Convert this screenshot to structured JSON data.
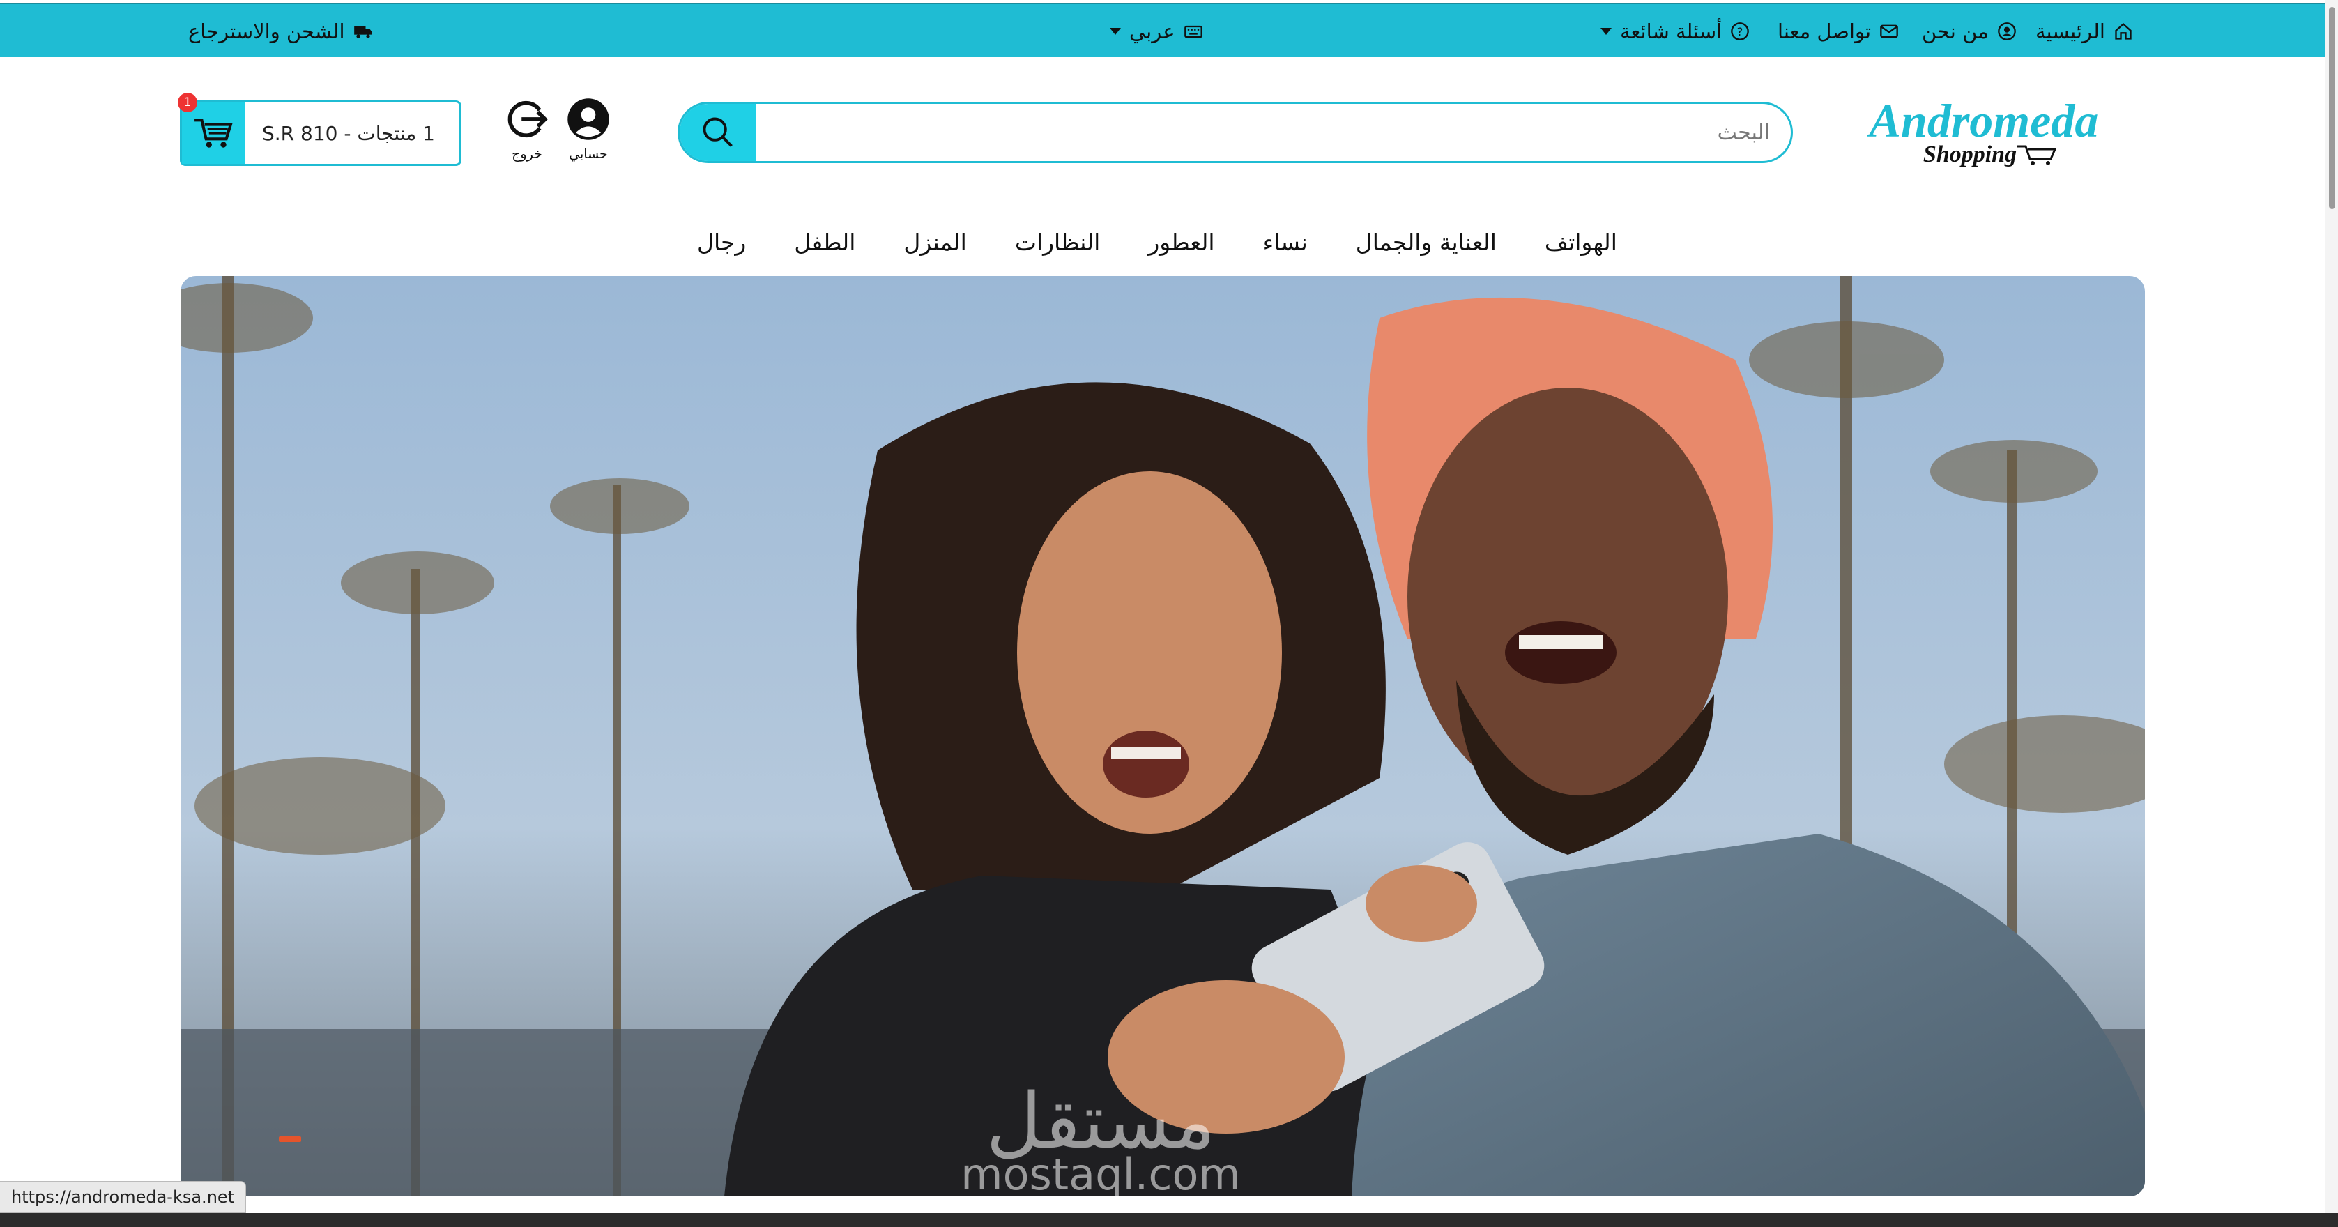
{
  "topbar": {
    "home": "الرئيسية",
    "about": "من نحن",
    "contact": "تواصل معنا",
    "faq": "أسئلة شائعة",
    "language": "عربي",
    "shipping": "الشحن والاسترجاع"
  },
  "header": {
    "logo_main": "Andromeda",
    "logo_sub": "Shopping",
    "search_placeholder": "البحث",
    "account_label": "حسابي",
    "logout_label": "خروج",
    "cart_summary": "1 منتجات - 810 S.R",
    "cart_count": "1"
  },
  "nav": {
    "items": [
      "الهواتف",
      "العناية والجمال",
      "نساء",
      "العطور",
      "النظارات",
      "المنزل",
      "الطفل",
      "رجال"
    ]
  },
  "hero": {
    "watermark_ar": "مستقل",
    "watermark_en": "mostaql.com"
  },
  "status_bar": {
    "url": "https://andromeda-ksa.net"
  },
  "colors": {
    "accent": "#1fbcd3",
    "button": "#1fd0e6",
    "badge": "#e33333",
    "slider_dot": "#e5542b"
  }
}
